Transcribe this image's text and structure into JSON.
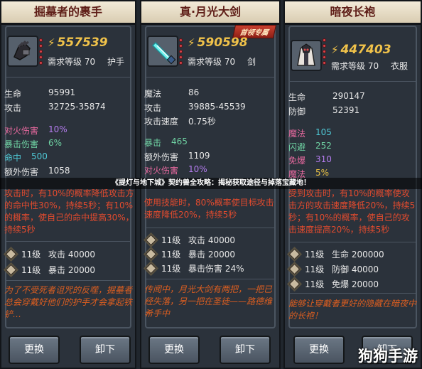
{
  "cards": [
    {
      "title": "掘墓者的裹手",
      "power": "557539",
      "req_level": "需求等级 70",
      "slot": "护手",
      "stats": [
        {
          "k": "生命",
          "v": "95991"
        },
        {
          "k": "攻击",
          "v": "32725-35874"
        },
        {
          "k": "对火伤害",
          "v": "10%"
        },
        {
          "k": "暴击伤害",
          "v": "6%"
        },
        {
          "k": "命中",
          "v": "500"
        },
        {
          "k": "额外伤害",
          "v": "1058"
        }
      ],
      "desc": "攻击时，有10%的概率降低攻击方的命中性30%，持续5秒；有10%的概率，使自己的命中提高30%，持续5秒",
      "levels": [
        {
          "lv": "11级",
          "text": "攻击 40000"
        },
        {
          "lv": "11级",
          "text": "暴击 20000"
        }
      ],
      "lore": "为了不受死者诅咒的反噬，掘墓者总会穿戴好他们的护手才会拿起铁铲…",
      "btn_swap": "更换",
      "btn_remove": "卸下"
    },
    {
      "title": "真·月光大剑",
      "tag": "首领专属",
      "power": "590598",
      "req_level": "需求等级 70",
      "slot": "剑",
      "stats": [
        {
          "k": "魔法",
          "v": "86"
        },
        {
          "k": "攻击",
          "v": "39885-45539"
        },
        {
          "k": "攻击速度",
          "v": "0.75秒"
        },
        {
          "k": "暴击",
          "v": "465"
        },
        {
          "k": "额外伤害",
          "v": "1109"
        },
        {
          "k": "对火伤害",
          "v": "10%"
        }
      ],
      "desc": "使用技能时，80%概率使目标攻击速度降低20%，持续5秒",
      "levels": [
        {
          "lv": "11级",
          "text": "攻击 40000"
        },
        {
          "lv": "11级",
          "text": "暴击 20000"
        },
        {
          "lv": "11级",
          "text": "暴击伤害 24%"
        }
      ],
      "lore": "传闻中，月光大剑有两把，一把已经失落，另一把在圣徒——路德维希手中",
      "btn_swap": "更换",
      "btn_remove": "卸下"
    },
    {
      "title": "暗夜长袍",
      "power": "447403",
      "req_level": "需求等级 70",
      "slot": "衣服",
      "stats": [
        {
          "k": "生命",
          "v": "290147"
        },
        {
          "k": "防御",
          "v": "52391"
        },
        {
          "k": "魔法",
          "v": "105"
        },
        {
          "k": "闪避",
          "v": "252"
        },
        {
          "k": "免爆",
          "v": "310"
        },
        {
          "k": "魔法",
          "v": "5%"
        }
      ],
      "desc": "受到攻击时，有10%的概率使攻击方的攻击速度降低20%，持续5秒；有10%的概率，使自己的攻击速度提高20%，持续5秒",
      "levels": [
        {
          "lv": "11级",
          "text": "生命 200000"
        },
        {
          "lv": "11级",
          "text": "防御 40000"
        },
        {
          "lv": "11级",
          "text": "免爆 20000"
        }
      ],
      "lore": "能够让穿戴者更好的隐藏在暗夜中的长袍！",
      "btn_swap": "更换",
      "btn_remove": "卸下"
    }
  ],
  "banner": "《提灯与地下城》契约兽全攻略：揭秘获取途径与掉落宝藏地！",
  "watermark": "狗狗手游",
  "colors": {
    "title_text": "#5e1d17",
    "power": "#f0c24a",
    "desc": "#e44b2e",
    "lore": "#dc5e20"
  }
}
